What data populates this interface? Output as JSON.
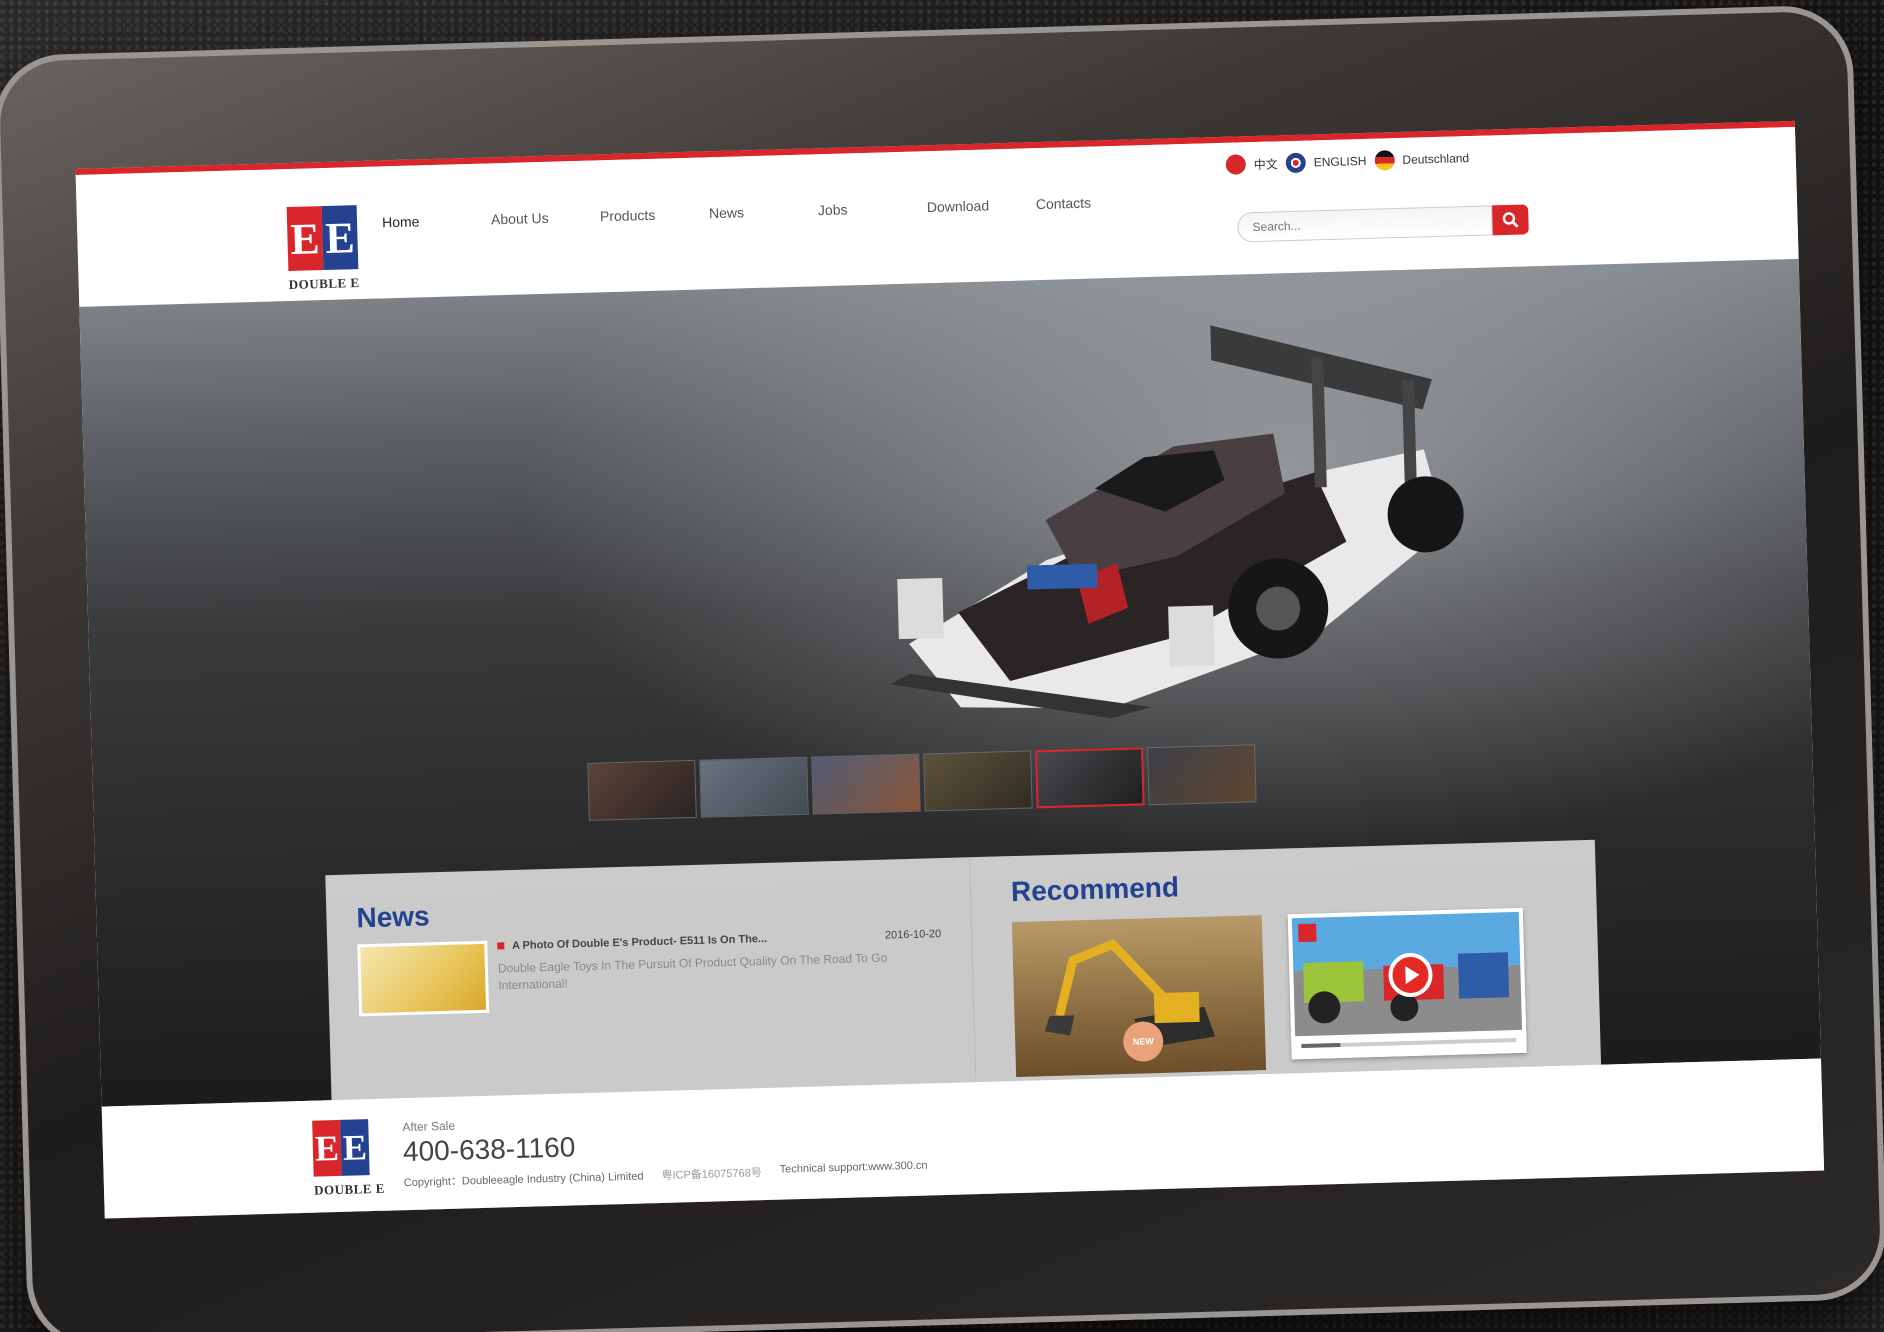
{
  "nav": {
    "items": [
      "Home",
      "About Us",
      "Products",
      "News",
      "Jobs",
      "Download",
      "Contacts"
    ],
    "active_index": 0
  },
  "brand": {
    "logo_letters": [
      "E",
      "E"
    ],
    "name": "DOUBLE E"
  },
  "languages": {
    "chinese": "中文",
    "english": "ENGLISH",
    "german": "Deutschland"
  },
  "search": {
    "placeholder": "Search..."
  },
  "news": {
    "title": "News",
    "item": {
      "title": "A Photo Of Double E's Product- E511 Is On The...",
      "date": "2016-10-20",
      "desc": "Double Eagle Toys In The Pursuit Of Product Quality On The Road To Go International!"
    }
  },
  "recommend": {
    "title": "Recommend",
    "badge": "NEW"
  },
  "footer": {
    "after_sale_label": "After Sale",
    "phone": "400-638-1160",
    "copyright": "Copyright：Doubleeagle Industry (China) Limited",
    "icp": "粤ICP备16075768号",
    "tech_support": "Technical support:www.300.cn"
  },
  "colors": {
    "brand_red": "#d8262b",
    "brand_blue": "#24428f"
  },
  "hero": {
    "thumbnail_count": 6,
    "active_thumbnail": 4
  },
  "video_progress": 0.18
}
